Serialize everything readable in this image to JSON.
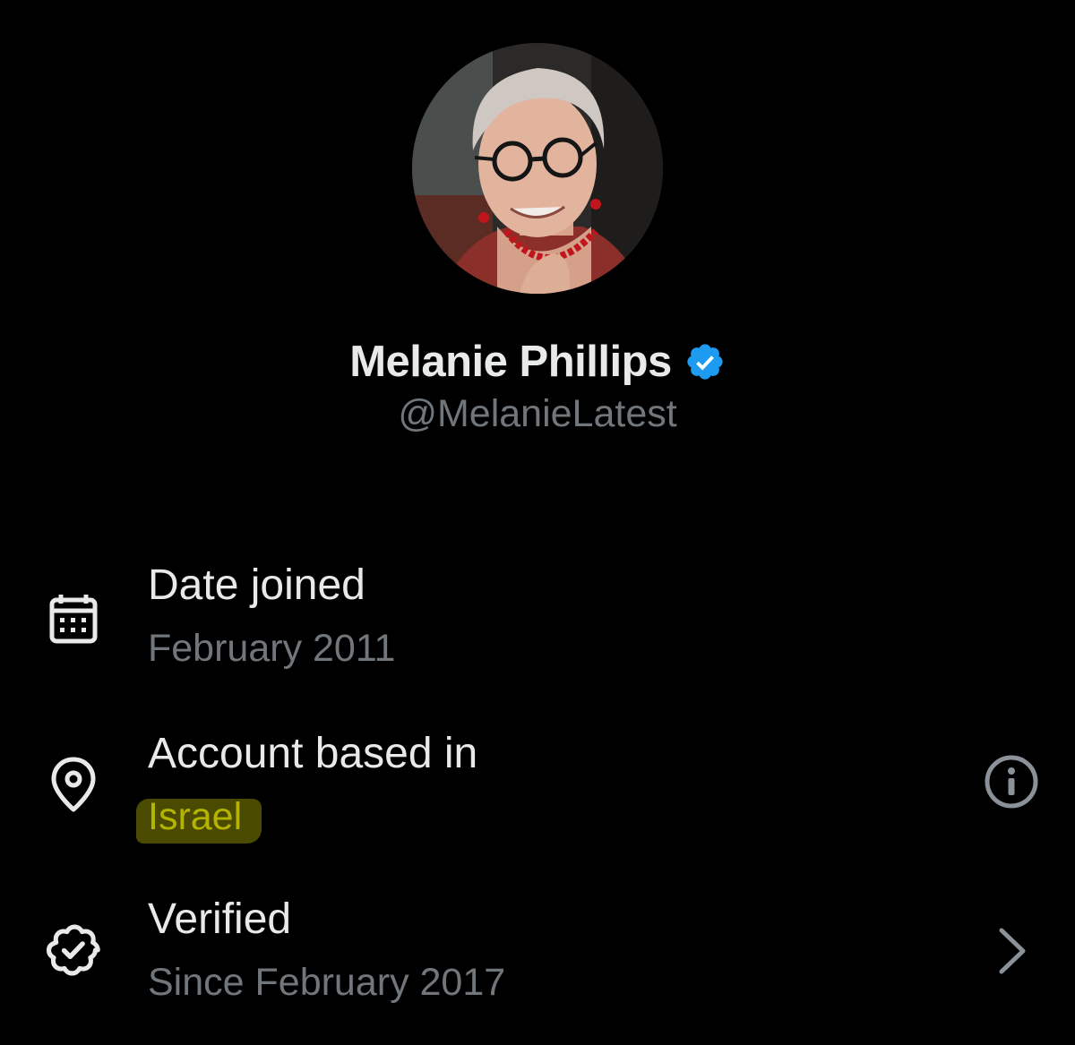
{
  "profile": {
    "name": "Melanie Phillips",
    "handle": "@MelanieLatest",
    "avatar": "avatar-photo",
    "verified_badge_color": "#1d9bf0"
  },
  "about_rows": [
    {
      "icon": "calendar-icon",
      "label": "Date joined",
      "value": "February 2011"
    },
    {
      "icon": "location-pin-icon",
      "label": "Account based in",
      "value": "Israel",
      "value_highlighted": true,
      "trailing_icon": "info-icon"
    },
    {
      "icon": "verified-badge-outline-icon",
      "label": "Verified",
      "value": "Since February 2017",
      "trailing_icon": "chevron-right-icon"
    }
  ],
  "colors": {
    "background": "#000000",
    "primary_text": "#e7e9ea",
    "secondary_text": "#71767b",
    "accent": "#1d9bf0",
    "highlight_bg": "#4a4a00",
    "highlight_text": "#b4b400"
  }
}
